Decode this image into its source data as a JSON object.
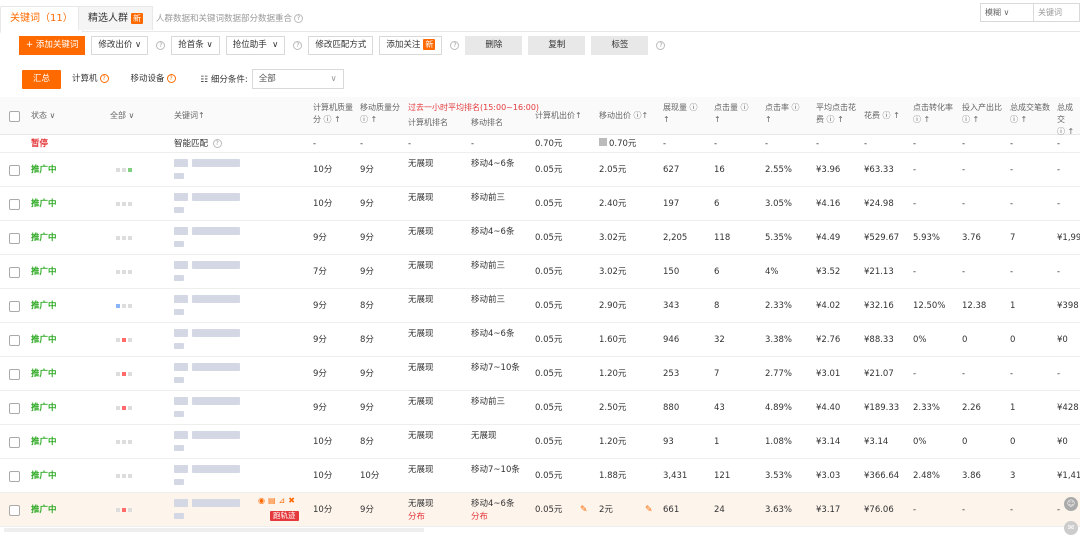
{
  "tabs": {
    "keywords": "关键词（11）",
    "crowd": "精选人群",
    "new_badge": "新",
    "note": "人群数据和关键词数据部分数据重合"
  },
  "top_right": {
    "mode": "模糊",
    "search_placeholder": "关键词"
  },
  "toolbar": {
    "add": "+ 添加关键词",
    "edit_bid": "修改出价",
    "grab_first": "抢首条",
    "rank_assist": "抢位助手",
    "edit_match": "修改匹配方式",
    "add_follow": "添加关注",
    "delete": "删除",
    "copy": "复制",
    "tag": "标签"
  },
  "filters": {
    "summary": "汇总",
    "computer": "计算机",
    "mobile": "移动设备",
    "detail_label": "细分条件:",
    "detail_value": "全部"
  },
  "columns": {
    "status": "状态",
    "all": "全部",
    "keyword": "关键词",
    "pc_quality": [
      "计算机质量",
      "分"
    ],
    "mob_quality": [
      "移动质量分",
      ""
    ],
    "rank_title": "过去一小时平均排名(15:00~16:00)",
    "pc_rank": "计算机排名",
    "mob_rank": "移动排名",
    "pc_bid": "计算机出价",
    "mob_bid": "移动出价",
    "impressions": "展现量",
    "clicks": "点击量",
    "ctr": "点击率",
    "cpc": [
      "平均点击花",
      "费"
    ],
    "cost": "花费",
    "cvr": "点击转化率",
    "roi": "投入产出比",
    "orders": "总成交笔数",
    "gmv": "总成交"
  },
  "smart_row": {
    "status": "暂停",
    "keyword": "智能匹配",
    "pc_quality": "-",
    "mob_quality": "-",
    "pc_rank": "-",
    "mob_rank": "-",
    "pc_bid": "0.70元",
    "mob_bid": "0.70元",
    "impressions": "-",
    "clicks": "-",
    "ctr": "-",
    "cpc": "-",
    "cost": "-",
    "cvr": "-",
    "roi": "-",
    "orders": "-",
    "gmv": "-"
  },
  "rows": [
    {
      "status": "推广中",
      "pc_quality": "10分",
      "mob_quality": "9分",
      "pc_rank": "无展现",
      "mob_rank": "移动4~6条",
      "pc_bid": "0.05元",
      "mob_bid": "2.05元",
      "impressions": "627",
      "clicks": "16",
      "ctr": "2.55%",
      "cpc": "¥3.96",
      "cost": "¥63.33",
      "cvr": "-",
      "roi": "-",
      "orders": "-",
      "gmv": "-"
    },
    {
      "status": "推广中",
      "pc_quality": "10分",
      "mob_quality": "9分",
      "pc_rank": "无展现",
      "mob_rank": "移动前三",
      "pc_bid": "0.05元",
      "mob_bid": "2.40元",
      "impressions": "197",
      "clicks": "6",
      "ctr": "3.05%",
      "cpc": "¥4.16",
      "cost": "¥24.98",
      "cvr": "-",
      "roi": "-",
      "orders": "-",
      "gmv": "-"
    },
    {
      "status": "推广中",
      "pc_quality": "9分",
      "mob_quality": "9分",
      "pc_rank": "无展现",
      "mob_rank": "移动4~6条",
      "pc_bid": "0.05元",
      "mob_bid": "3.02元",
      "impressions": "2,205",
      "clicks": "118",
      "ctr": "5.35%",
      "cpc": "¥4.49",
      "cost": "¥529.67",
      "cvr": "5.93%",
      "roi": "3.76",
      "orders": "7",
      "gmv": "¥1,99"
    },
    {
      "status": "推广中",
      "pc_quality": "7分",
      "mob_quality": "9分",
      "pc_rank": "无展现",
      "mob_rank": "移动前三",
      "pc_bid": "0.05元",
      "mob_bid": "3.02元",
      "impressions": "150",
      "clicks": "6",
      "ctr": "4%",
      "cpc": "¥3.52",
      "cost": "¥21.13",
      "cvr": "-",
      "roi": "-",
      "orders": "-",
      "gmv": "-"
    },
    {
      "status": "推广中",
      "pc_quality": "9分",
      "mob_quality": "8分",
      "pc_rank": "无展现",
      "mob_rank": "移动前三",
      "pc_bid": "0.05元",
      "mob_bid": "2.90元",
      "impressions": "343",
      "clicks": "8",
      "ctr": "2.33%",
      "cpc": "¥4.02",
      "cost": "¥32.16",
      "cvr": "12.50%",
      "roi": "12.38",
      "orders": "1",
      "gmv": "¥398"
    },
    {
      "status": "推广中",
      "pc_quality": "9分",
      "mob_quality": "8分",
      "pc_rank": "无展现",
      "mob_rank": "移动4~6条",
      "pc_bid": "0.05元",
      "mob_bid": "1.60元",
      "impressions": "946",
      "clicks": "32",
      "ctr": "3.38%",
      "cpc": "¥2.76",
      "cost": "¥88.33",
      "cvr": "0%",
      "roi": "0",
      "orders": "0",
      "gmv": "¥0"
    },
    {
      "status": "推广中",
      "pc_quality": "9分",
      "mob_quality": "9分",
      "pc_rank": "无展现",
      "mob_rank": "移动7~10条",
      "pc_bid": "0.05元",
      "mob_bid": "1.20元",
      "impressions": "253",
      "clicks": "7",
      "ctr": "2.77%",
      "cpc": "¥3.01",
      "cost": "¥21.07",
      "cvr": "-",
      "roi": "-",
      "orders": "-",
      "gmv": "-"
    },
    {
      "status": "推广中",
      "pc_quality": "9分",
      "mob_quality": "9分",
      "pc_rank": "无展现",
      "mob_rank": "移动前三",
      "pc_bid": "0.05元",
      "mob_bid": "2.50元",
      "impressions": "880",
      "clicks": "43",
      "ctr": "4.89%",
      "cpc": "¥4.40",
      "cost": "¥189.33",
      "cvr": "2.33%",
      "roi": "2.26",
      "orders": "1",
      "gmv": "¥428"
    },
    {
      "status": "推广中",
      "pc_quality": "10分",
      "mob_quality": "8分",
      "pc_rank": "无展现",
      "mob_rank": "无展现",
      "pc_bid": "0.05元",
      "mob_bid": "1.20元",
      "impressions": "93",
      "clicks": "1",
      "ctr": "1.08%",
      "cpc": "¥3.14",
      "cost": "¥3.14",
      "cvr": "0%",
      "roi": "0",
      "orders": "0",
      "gmv": "¥0"
    },
    {
      "status": "推广中",
      "pc_quality": "10分",
      "mob_quality": "10分",
      "pc_rank": "无展现",
      "mob_rank": "移动7~10条",
      "pc_bid": "0.05元",
      "mob_bid": "1.88元",
      "impressions": "3,431",
      "clicks": "121",
      "ctr": "3.53%",
      "cpc": "¥3.03",
      "cost": "¥366.64",
      "cvr": "2.48%",
      "roi": "3.86",
      "orders": "3",
      "gmv": "¥1,41"
    },
    {
      "status": "推广中",
      "pc_quality": "10分",
      "mob_quality": "9分",
      "pc_rank": "无展现",
      "mob_rank": "移动4~6条",
      "pc_bid": "0.05元",
      "mob_bid": "2元",
      "impressions": "661",
      "clicks": "24",
      "ctr": "3.63%",
      "cpc": "¥3.17",
      "cost": "¥76.06",
      "cvr": "-",
      "roi": "-",
      "orders": "-",
      "gmv": "-",
      "distribution": "分布",
      "track_tag": "跑轨迹"
    }
  ],
  "colors": {
    "accent": "#ff6a00",
    "active": "#2eaa24",
    "paused": "#e4393c"
  }
}
